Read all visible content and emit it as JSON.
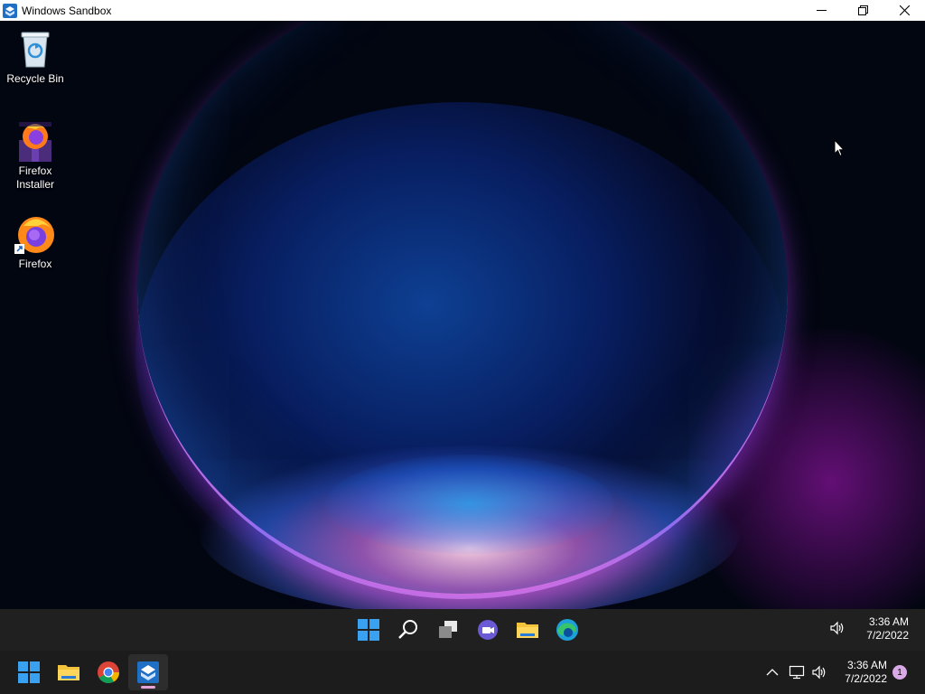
{
  "window": {
    "title": "Windows Sandbox",
    "controls": [
      "minimize",
      "restore",
      "close"
    ]
  },
  "desktop": {
    "icons": [
      {
        "label": "Recycle Bin",
        "icon": "recycle-bin-icon"
      },
      {
        "label": "Firefox\nInstaller",
        "icon": "firefox-installer-icon"
      },
      {
        "label": "Firefox",
        "icon": "firefox-icon",
        "shortcut": true
      }
    ]
  },
  "inner_taskbar": {
    "apps": [
      "start-icon",
      "search-icon",
      "task-view-icon",
      "teams-chat-icon",
      "file-explorer-icon",
      "edge-icon"
    ],
    "clock": {
      "time": "3:36 AM",
      "date": "7/2/2022"
    }
  },
  "host_taskbar": {
    "apps": [
      "start-icon",
      "file-explorer-icon",
      "chrome-icon",
      "windows-sandbox-icon"
    ],
    "active_app": "windows-sandbox-icon",
    "clock": {
      "time": "3:36 AM",
      "date": "7/2/2022"
    },
    "notification_count": "1"
  },
  "colors": {
    "taskbar": "#202020",
    "accent_indicator": "#e6a3d9",
    "title_bar": "#ffffff"
  }
}
